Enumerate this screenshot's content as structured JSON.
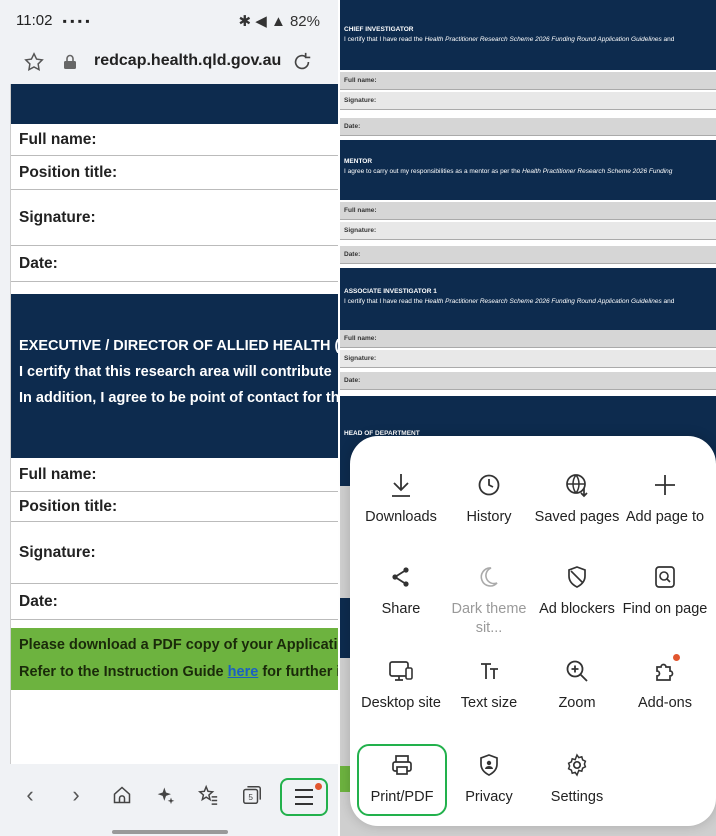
{
  "status": {
    "time": "11:02",
    "right_icons": "✱ ◀ ▲ 82%"
  },
  "browser": {
    "url": "redcap.health.qld.gov.au"
  },
  "left_form": {
    "rows_a": [
      "Full name:",
      "Position title:",
      "Signature:",
      "Date:"
    ],
    "exec_title": "EXECUTIVE / DIRECTOR OF ALLIED HEALTH (OR",
    "exec_line1": "I certify that this research area will contribute",
    "exec_line2": "In addition, I agree to be point of contact for th",
    "rows_b": [
      "Full name:",
      "Position title:",
      "Signature:",
      "Date:"
    ],
    "green_line1": "Please download a PDF copy of your Application",
    "green_line2_pre": "Refer to the Instruction Guide ",
    "green_link": "here",
    "green_line2_post": " for further ins"
  },
  "right_doc": {
    "chief": {
      "title": "CHIEF INVESTIGATOR",
      "desc_pre": "I certify that I have read the ",
      "desc_em": "Health Practitioner Research Scheme 2026 Funding Round Application Guidelines",
      "desc_post": " and"
    },
    "chief_fields": [
      "Full name:",
      "Signature:",
      "Date:"
    ],
    "mentor": {
      "title": "MENTOR",
      "desc_pre": "I agree to carry out my responsibilities as a mentor as per the ",
      "desc_em": "Health Practitioner Research Scheme 2026 Funding",
      "desc_post": ""
    },
    "mentor_fields": [
      "Full name:",
      "Signature:",
      "Date:"
    ],
    "assoc": {
      "title": "ASSOCIATE INVESTIGATOR 1",
      "desc_pre": "I certify that I have read the ",
      "desc_em": "Health Practitioner Research Scheme 2026 Funding Round Application Guidelines",
      "desc_post": " and"
    },
    "assoc_fields": [
      "Full name:",
      "Signature:",
      "Date:"
    ],
    "hod": {
      "title": "HEAD OF DEPARTMENT"
    }
  },
  "menu": {
    "items": [
      {
        "label": "Downloads",
        "icon": "download-icon"
      },
      {
        "label": "History",
        "icon": "history-icon"
      },
      {
        "label": "Saved pages",
        "icon": "saved-pages-icon"
      },
      {
        "label": "Add page to",
        "icon": "plus-icon"
      },
      {
        "label": "Share",
        "icon": "share-icon"
      },
      {
        "label": "Dark theme sit...",
        "icon": "moon-icon"
      },
      {
        "label": "Ad blockers",
        "icon": "shield-icon"
      },
      {
        "label": "Find on page",
        "icon": "find-icon"
      },
      {
        "label": "Desktop site",
        "icon": "desktop-icon"
      },
      {
        "label": "Text size",
        "icon": "text-size-icon"
      },
      {
        "label": "Zoom",
        "icon": "zoom-icon"
      },
      {
        "label": "Add-ons",
        "icon": "puzzle-icon"
      },
      {
        "label": "Print/PDF",
        "icon": "print-icon"
      },
      {
        "label": "Privacy",
        "icon": "privacy-icon"
      },
      {
        "label": "Settings",
        "icon": "gear-icon"
      }
    ]
  },
  "colors": {
    "navy": "#0d2b4e",
    "green_banner": "#6db33f",
    "highlight": "#22b14c",
    "badge": "#e2562e"
  }
}
